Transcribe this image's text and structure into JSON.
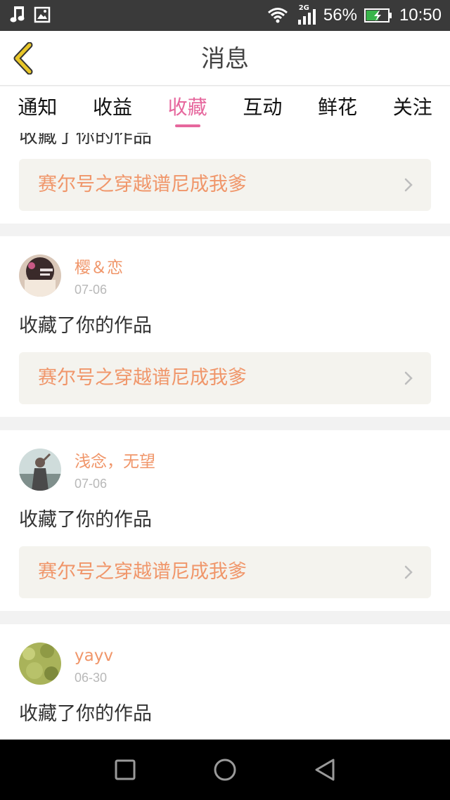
{
  "status_bar": {
    "network": "2G",
    "battery": "56%",
    "time": "10:50"
  },
  "header": {
    "title": "消息"
  },
  "tabs": [
    {
      "label": "通知",
      "active": false
    },
    {
      "label": "收益",
      "active": false
    },
    {
      "label": "收藏",
      "active": true
    },
    {
      "label": "互动",
      "active": false
    },
    {
      "label": "鲜花",
      "active": false
    },
    {
      "label": "关注",
      "active": false
    }
  ],
  "partial_item": {
    "action": "收藏了你的作品",
    "work_title": "赛尔号之穿越谱尼成我爹"
  },
  "items": [
    {
      "username": "樱＆恋",
      "date": "07-06",
      "action": "收藏了你的作品",
      "work_title": "赛尔号之穿越谱尼成我爹"
    },
    {
      "username": "浅念，无望",
      "date": "07-06",
      "action": "收藏了你的作品",
      "work_title": "赛尔号之穿越谱尼成我爹"
    },
    {
      "username": "yayv",
      "date": "06-30",
      "action": "收藏了你的作品",
      "work_title": ""
    }
  ],
  "icons": {
    "back": "chevron-left-icon",
    "nav": [
      "recent-apps-icon",
      "home-icon",
      "back-triangle-icon"
    ]
  },
  "colors": {
    "accent": "#e6679d",
    "username": "#f0966a",
    "work_bg": "#f4f3ee",
    "back_icon": "#e8c628"
  }
}
